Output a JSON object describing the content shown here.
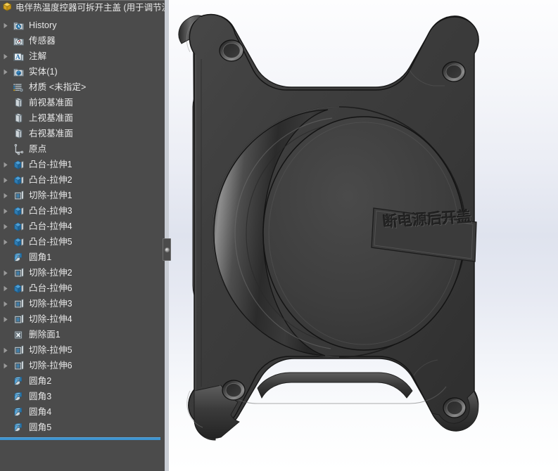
{
  "app": {
    "document_title": "电伴热温度控器可拆开主盖 (用于调节温",
    "document_icon": "part-document-icon"
  },
  "feature_tree": {
    "panel_name": "FeatureManager design tree",
    "rollback_bar_color": "#3d93d0",
    "background_color": "#4b4b4b",
    "text_color": "#e9e9e9",
    "items": [
      {
        "label": "History",
        "icon": "history-folder-icon",
        "expandable": true,
        "indent": 0
      },
      {
        "label": "传感器",
        "icon": "sensors-folder-icon",
        "expandable": false,
        "indent": 0
      },
      {
        "label": "注解",
        "icon": "annotations-icon",
        "expandable": true,
        "indent": 0
      },
      {
        "label": "实体(1)",
        "icon": "solid-bodies-icon",
        "expandable": true,
        "indent": 0
      },
      {
        "label": "材质 <未指定>",
        "icon": "material-icon",
        "expandable": false,
        "indent": 0
      },
      {
        "label": "前视基准面",
        "icon": "plane-icon",
        "expandable": false,
        "indent": 0
      },
      {
        "label": "上视基准面",
        "icon": "plane-icon",
        "expandable": false,
        "indent": 0
      },
      {
        "label": "右视基准面",
        "icon": "plane-icon",
        "expandable": false,
        "indent": 0
      },
      {
        "label": "原点",
        "icon": "origin-icon",
        "expandable": false,
        "indent": 0
      },
      {
        "label": "凸台-拉伸1",
        "icon": "boss-extrude-icon",
        "expandable": true,
        "indent": 0
      },
      {
        "label": "凸台-拉伸2",
        "icon": "boss-extrude-icon",
        "expandable": true,
        "indent": 0
      },
      {
        "label": "切除-拉伸1",
        "icon": "cut-extrude-icon",
        "expandable": true,
        "indent": 0
      },
      {
        "label": "凸台-拉伸3",
        "icon": "boss-extrude-icon",
        "expandable": true,
        "indent": 0
      },
      {
        "label": "凸台-拉伸4",
        "icon": "boss-extrude-icon",
        "expandable": true,
        "indent": 0
      },
      {
        "label": "凸台-拉伸5",
        "icon": "boss-extrude-icon",
        "expandable": true,
        "indent": 0
      },
      {
        "label": "圆角1",
        "icon": "fillet-icon",
        "expandable": false,
        "indent": 0
      },
      {
        "label": "切除-拉伸2",
        "icon": "cut-extrude-icon",
        "expandable": true,
        "indent": 0
      },
      {
        "label": "凸台-拉伸6",
        "icon": "boss-extrude-icon",
        "expandable": true,
        "indent": 0
      },
      {
        "label": "切除-拉伸3",
        "icon": "cut-extrude-icon",
        "expandable": true,
        "indent": 0
      },
      {
        "label": "切除-拉伸4",
        "icon": "cut-extrude-icon",
        "expandable": true,
        "indent": 0
      },
      {
        "label": "删除面1",
        "icon": "delete-face-icon",
        "expandable": false,
        "indent": 0
      },
      {
        "label": "切除-拉伸5",
        "icon": "cut-extrude-icon",
        "expandable": true,
        "indent": 0
      },
      {
        "label": "切除-拉伸6",
        "icon": "cut-extrude-icon",
        "expandable": true,
        "indent": 0
      },
      {
        "label": "圆角2",
        "icon": "fillet-icon",
        "expandable": false,
        "indent": 0
      },
      {
        "label": "圆角3",
        "icon": "fillet-icon",
        "expandable": false,
        "indent": 0
      },
      {
        "label": "圆角4",
        "icon": "fillet-icon",
        "expandable": false,
        "indent": 0
      },
      {
        "label": "圆角5",
        "icon": "fillet-icon",
        "expandable": false,
        "indent": 0
      }
    ]
  },
  "viewport": {
    "name": "graphics-area",
    "model_name": "电伴热温度控器可拆开主盖",
    "model_color": "#3a3a3a",
    "embossed_text": "断电源后开盖",
    "background_gradient_top": "#fdfdfe",
    "background_gradient_mid": "#dfe3ee",
    "background_gradient_bottom": "#ffffff"
  },
  "splitter": {
    "name": "panel-splitter",
    "handle_icon": "splitter-grip-icon"
  }
}
